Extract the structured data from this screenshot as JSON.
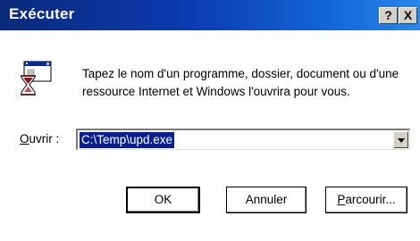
{
  "window": {
    "title": "Exécuter",
    "help_label": "?",
    "close_label": "X"
  },
  "description": "Tapez le nom d'un programme, dossier, document ou d'une ressource Internet et Windows l'ouvrira pour vous.",
  "open_field": {
    "label_accel": "O",
    "label_rest": "uvrir :",
    "value": "C:\\Temp\\upd.exe"
  },
  "buttons": {
    "ok": "OK",
    "cancel": "Annuler",
    "browse_accel": "P",
    "browse_rest": "arcourir..."
  },
  "icons": {
    "run": "run-hourglass-window-icon",
    "help": "help-icon",
    "close": "close-icon",
    "dropdown": "chevron-down-icon"
  },
  "colors": {
    "titlebar_start": "#0a2a7a",
    "titlebar_end": "#2a86ea",
    "selection": "#0a1f8f",
    "button_face": "#d4d0c8"
  }
}
